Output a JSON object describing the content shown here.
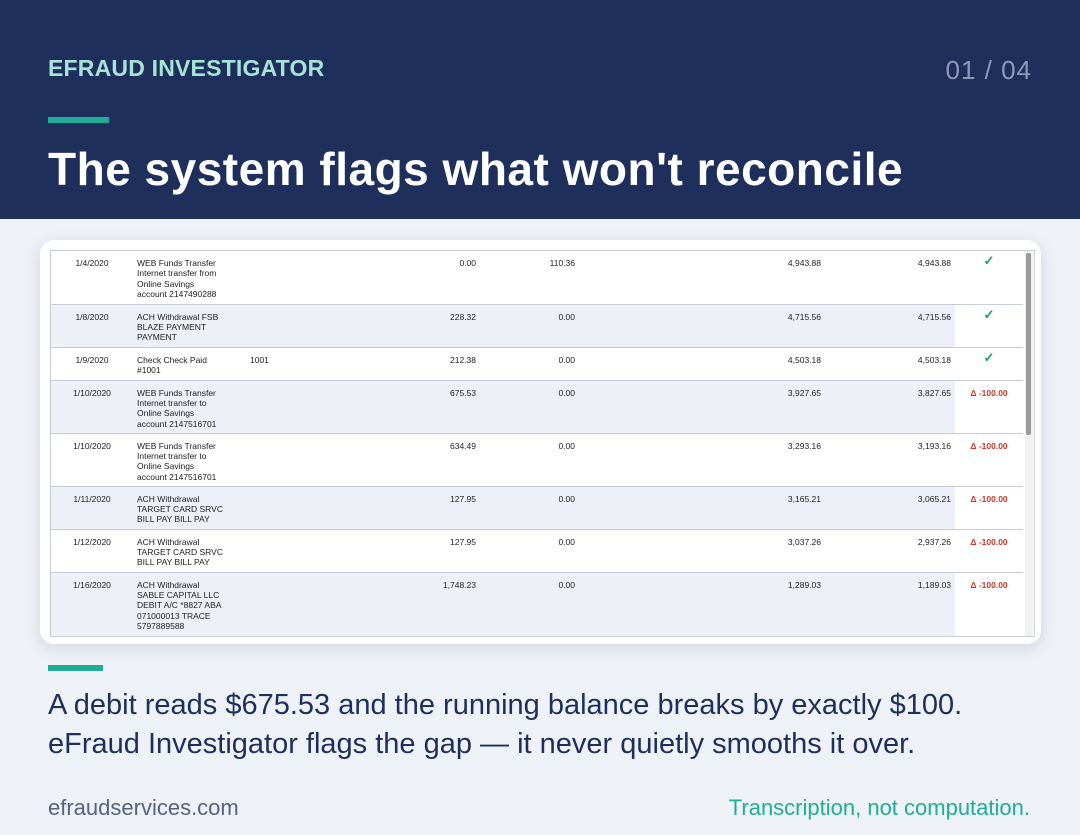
{
  "header": {
    "brand": "EFRAUD INVESTIGATOR",
    "page_counter": "01 / 04",
    "headline": "The system flags what won't reconcile"
  },
  "ledger": {
    "rows": [
      {
        "date": "1/4/2020",
        "description": "WEB Funds Transfer\nInternet transfer from\nOnline Savings\naccount 2147490288",
        "check_no": "",
        "debit": "0.00",
        "credit": "110.36",
        "running_balance": "4,943.88",
        "reported_balance": "4,943.88",
        "status": "ok",
        "status_text": "✓"
      },
      {
        "date": "1/8/2020",
        "description": "ACH Withdrawal FSB\nBLAZE PAYMENT\nPAYMENT",
        "check_no": "",
        "debit": "228.32",
        "credit": "0.00",
        "running_balance": "4,715.56",
        "reported_balance": "4,715.56",
        "status": "ok",
        "status_text": "✓"
      },
      {
        "date": "1/9/2020",
        "description": "Check Check Paid\n#1001",
        "check_no": "1001",
        "debit": "212.38",
        "credit": "0.00",
        "running_balance": "4,503.18",
        "reported_balance": "4,503.18",
        "status": "ok",
        "status_text": "✓"
      },
      {
        "date": "1/10/2020",
        "description": "WEB Funds Transfer\nInternet transfer to\nOnline Savings\naccount 2147516701",
        "check_no": "",
        "debit": "675.53",
        "credit": "0.00",
        "running_balance": "3,927.65",
        "reported_balance": "3,827.65",
        "status": "flag",
        "status_text": "Δ -100.00"
      },
      {
        "date": "1/10/2020",
        "description": "WEB Funds Transfer\nInternet transfer to\nOnline Savings\naccount 2147516701",
        "check_no": "",
        "debit": "634.49",
        "credit": "0.00",
        "running_balance": "3,293.16",
        "reported_balance": "3,193.16",
        "status": "flag",
        "status_text": "Δ -100.00"
      },
      {
        "date": "1/11/2020",
        "description": "ACH Withdrawal\nTARGET CARD SRVC\nBILL PAY BILL PAY",
        "check_no": "",
        "debit": "127.95",
        "credit": "0.00",
        "running_balance": "3,165.21",
        "reported_balance": "3,065.21",
        "status": "flag",
        "status_text": "Δ -100.00"
      },
      {
        "date": "1/12/2020",
        "description": "ACH Withdrawal\nTARGET CARD SRVC\nBILL PAY BILL PAY",
        "check_no": "",
        "debit": "127.95",
        "credit": "0.00",
        "running_balance": "3,037.26",
        "reported_balance": "2,937.26",
        "status": "flag",
        "status_text": "Δ -100.00"
      },
      {
        "date": "1/16/2020",
        "description": "ACH Withdrawal\nSABLE CAPITAL LLC\nDEBIT A/C *8827 ABA\n071000013 TRACE\n5797889588",
        "check_no": "",
        "debit": "1,748.23",
        "credit": "0.00",
        "running_balance": "1,289.03",
        "reported_balance": "1,189.03",
        "status": "flag",
        "status_text": "Δ -100.00"
      }
    ]
  },
  "body": {
    "line1": "A debit reads $675.53 and the running balance breaks by exactly $100.",
    "line2": "eFraud Investigator flags the gap — it never quietly smooths it over."
  },
  "footer": {
    "website": "efraudservices.com",
    "tagline": "Transcription, not computation."
  },
  "colors": {
    "header_bg": "#1e2f5c",
    "accent": "#1fae93",
    "brand_text": "#a8e3d8",
    "ok_check": "#17a05c",
    "flag_red": "#c8382a",
    "page_bg": "#eef1f6"
  }
}
